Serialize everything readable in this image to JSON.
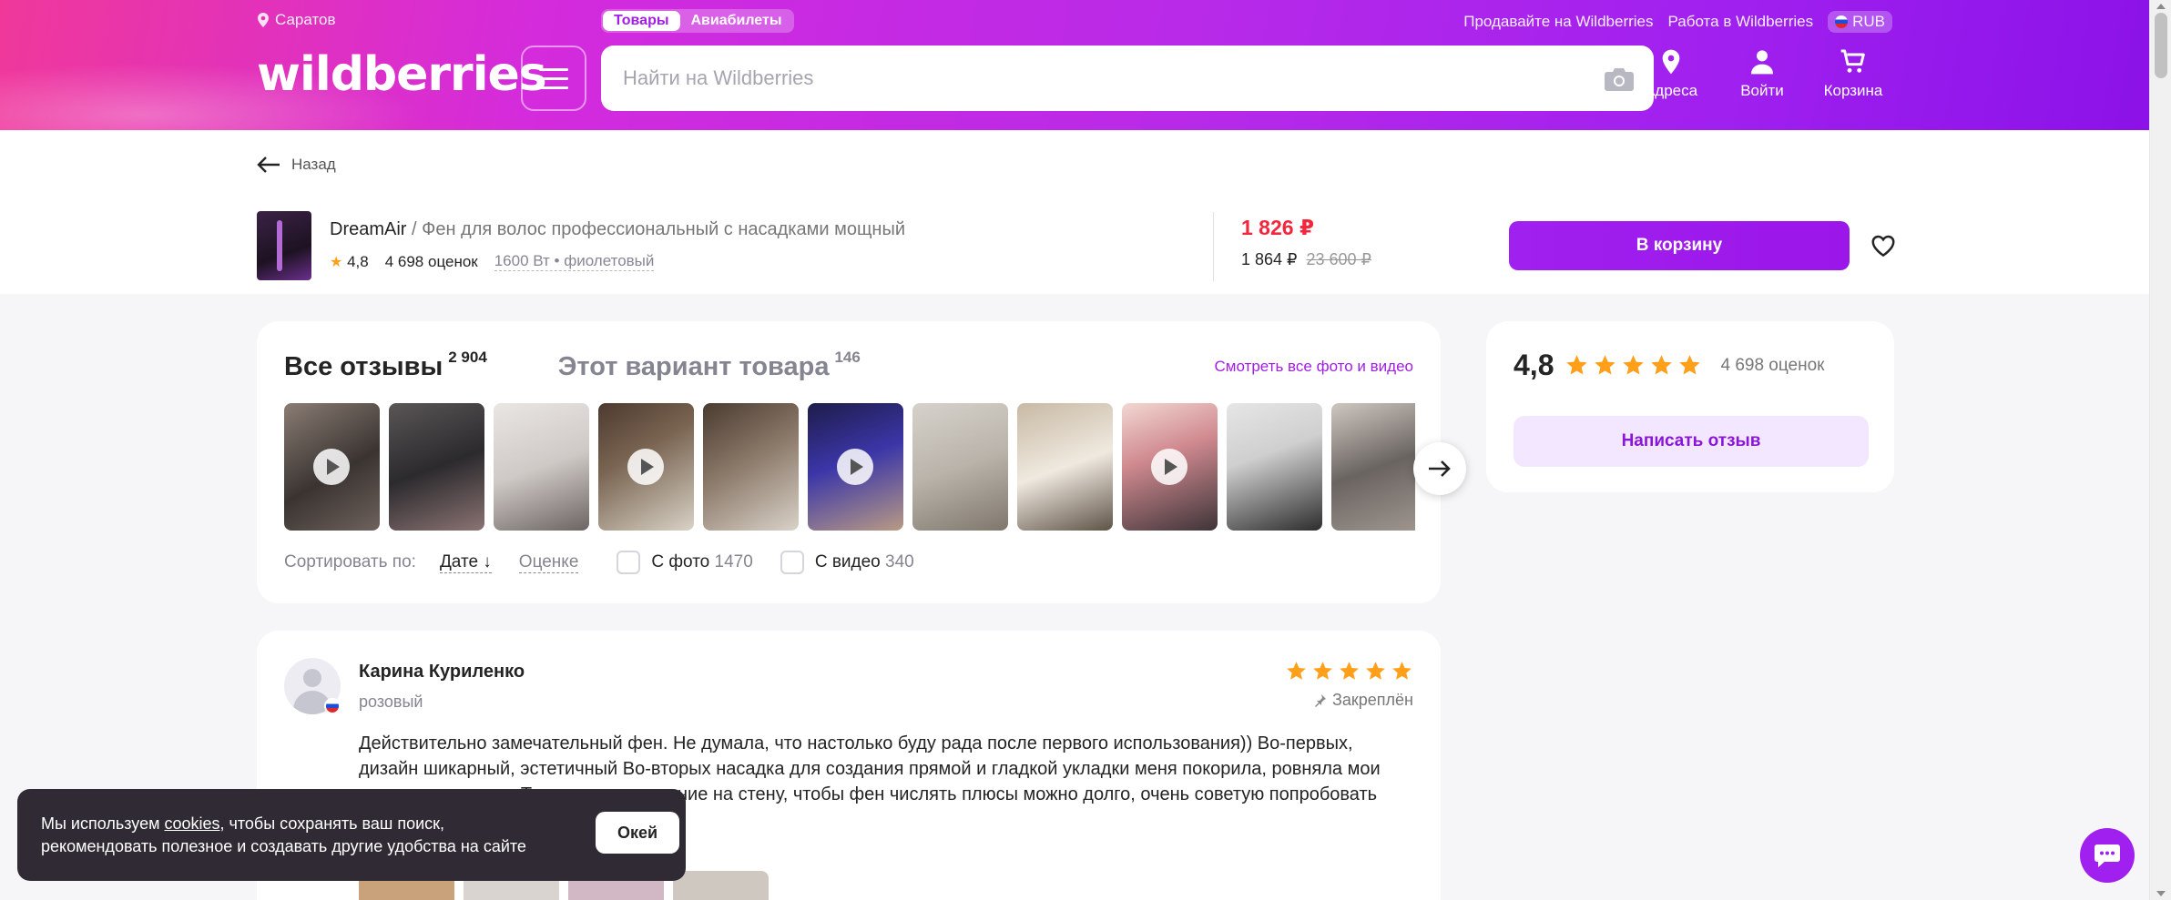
{
  "header": {
    "city": "Саратов",
    "segments": [
      "Товары",
      "Авиабилеты"
    ],
    "links": [
      "Продавайте на Wildberries",
      "Работа в Wildberries"
    ],
    "currency": "RUB",
    "logo": "wildberries",
    "search_placeholder": "Найти на Wildberries",
    "icons": [
      {
        "label": "Адреса",
        "icon": "location-icon"
      },
      {
        "label": "Войти",
        "icon": "user-icon"
      },
      {
        "label": "Корзина",
        "icon": "cart-icon"
      }
    ]
  },
  "product": {
    "back_label": "Назад",
    "brand": "DreamAir",
    "name": " / Фен для волос профессиональный с насадками мощный",
    "rating": "4,8",
    "ratings_count": "4 698 оценок",
    "variant": "1600 Вт • фиолетовый",
    "price_new": "1 826 ₽",
    "price_mid": "1 864 ₽",
    "price_old": "23 600 ₽",
    "cart_button": "В корзину"
  },
  "reviews": {
    "tab_all": "Все отзывы",
    "tab_all_count": "2 904",
    "tab_variant": "Этот вариант товара",
    "tab_variant_count": "146",
    "all_photos_link": "Смотреть все фото и видео",
    "sort_label": "Сортировать по:",
    "sort_date": "Дате",
    "sort_rating": "Оценке",
    "filter_photo": "С фото",
    "filter_photo_count": "1470",
    "filter_video": "С видео",
    "filter_video_count": "340"
  },
  "rating_summary": {
    "value": "4,8",
    "count": "4 698 оценок",
    "write_button": "Написать отзыв",
    "stars": 5
  },
  "review_item": {
    "user": "Карина Куриленко",
    "variant": "розовый",
    "stars": 5,
    "pinned": "Закреплён",
    "text": "Действительно замечательный фен. Не думала, что настолько буду рада после первого использования)) Во-первых, дизайн шикарный, эстетичный Во-вторых насадка для создания прямой и гладкой укладки меня покорила, ровняла мои пушистые волосы. Также есть крепление на стену, чтобы фен числять плюсы можно долго, очень советую попробовать фен в"
  },
  "cookie": {
    "text_before": "Мы используем ",
    "link": "cookies",
    "text_after": ", чтобы сохранять ваш поиск, рекомендовать полезное и создавать другие удобства на сайте",
    "ok_button": "Окей"
  },
  "colors": {
    "accent": "#a020ef",
    "price": "#f0283d",
    "star": "#ff9f1a"
  }
}
